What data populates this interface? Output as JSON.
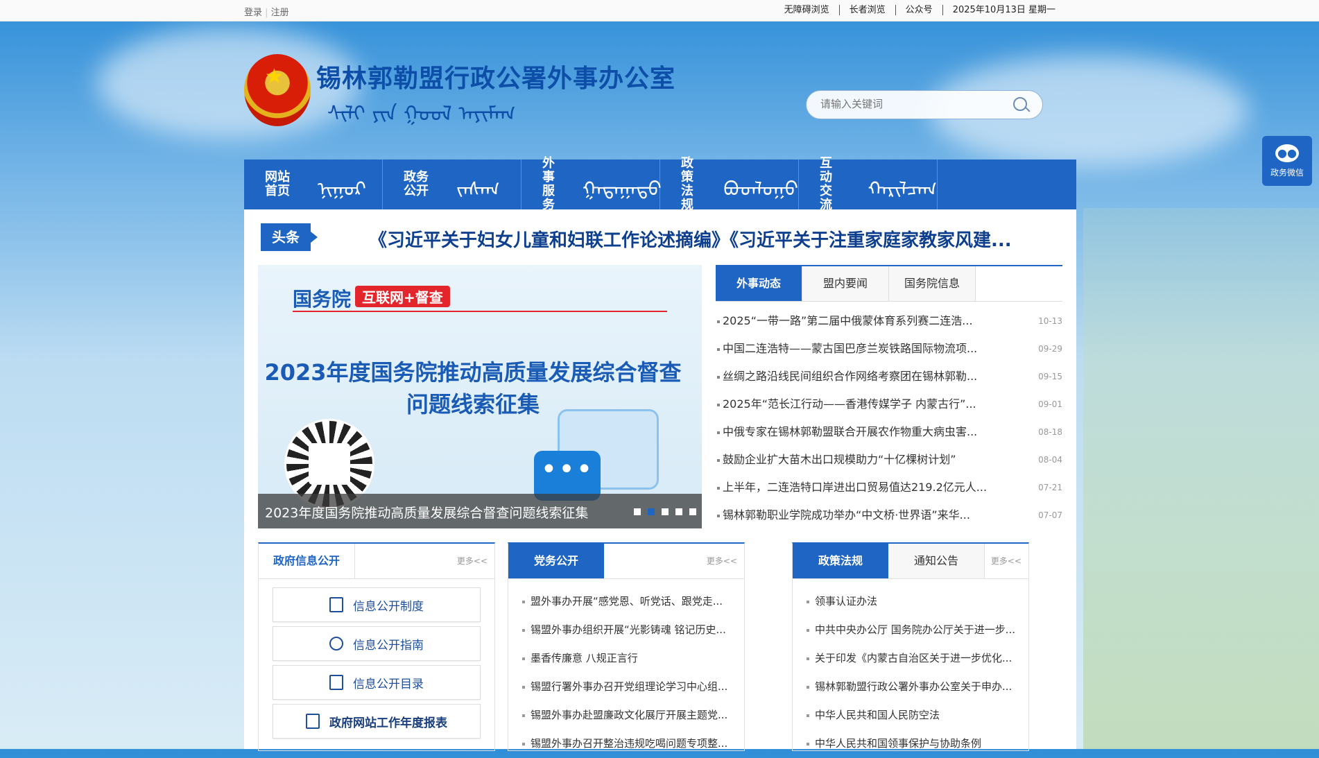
{
  "topbar": {
    "login": "登录",
    "register": "注册",
    "links": [
      "无障碍浏览",
      "长者浏览",
      "公众号",
      "2025年10月13日 星期一"
    ]
  },
  "header": {
    "title": "锡林郭勒盟行政公署外事办公室",
    "mongolian_title": "ᠰᠢᠯᠢ ᠶᠢᠨ ᠭᠣᠣᠯ ᠠᠶᠢᠮᠠᠭ",
    "search_placeholder": "请输入关键词"
  },
  "nav": [
    {
      "cn": "网站首页",
      "mn": "ᠨᠢᠭᠤᠷ"
    },
    {
      "cn": "政务公开",
      "mn": "ᠵᠠᠰᠠᠭ"
    },
    {
      "cn": "外事服务",
      "mn": "ᠭᠠᠳᠠᠭᠠᠳᠤ"
    },
    {
      "cn": "政策法规",
      "mn": "ᠪᠣᠳᠯᠣᠭᠣ"
    },
    {
      "cn": "互动交流",
      "mn": "ᠬᠠᠷᠢᠯᠴᠠᠭ"
    }
  ],
  "side": {
    "wechat_label": "政务微信"
  },
  "headline": {
    "tag": "头条",
    "text": "《习近平关于妇女儿童和妇联工作论述摘编》《习近平关于注重家庭家教家风建..."
  },
  "slider": {
    "brand": "国务院",
    "badge": "互联网+督查",
    "heading_line1": "2023年度国务院推动高质量发展综合督查",
    "heading_line2": "问题线索征集",
    "caption": "2023年度国务院推动高质量发展综合督查问题线索征集",
    "slide_count": 5,
    "active_slide": 2
  },
  "news": {
    "tabs": [
      "外事动态",
      "盟内要闻",
      "国务院信息"
    ],
    "active_tab": 0,
    "items": [
      {
        "title": "2025“一带一路”第二届中俄蒙体育系列赛二连浩...",
        "date": "10-13"
      },
      {
        "title": "中国二连浩特——蒙古国巴彦兰炭铁路国际物流项...",
        "date": "09-29"
      },
      {
        "title": "丝绸之路沿线民间组织合作网络考察团在锡林郭勒...",
        "date": "09-15"
      },
      {
        "title": "2025年“范长江行动——香港传媒学子 内蒙古行”...",
        "date": "09-01"
      },
      {
        "title": "中俄专家在锡林郭勒盟联合开展农作物重大病虫害...",
        "date": "08-18"
      },
      {
        "title": "鼓励企业扩大苗木出口规模助力“十亿棵树计划”",
        "date": "08-04"
      },
      {
        "title": "上半年，二连浩特口岸进出口贸易值达219.2亿元人...",
        "date": "07-21"
      },
      {
        "title": "锡林郭勒职业学院成功举办“中文桥·世界语”来华...",
        "date": "07-07"
      }
    ]
  },
  "col1": {
    "tab": "政府信息公开",
    "more": "更多<<",
    "buttons": [
      "信息公开制度",
      "信息公开指南",
      "信息公开目录",
      "政府网站工作年度报表"
    ]
  },
  "col2": {
    "tab": "党务公开",
    "more": "更多<<",
    "items": [
      "盟外事办开展“感党恩、听党话、跟党走...",
      "锡盟外事办组织开展“光影铸魂 铭记历史...",
      "墨香传廉意 八规正言行",
      "锡盟行署外事办召开党组理论学习中心组...",
      "锡盟外事办赴盟廉政文化展厅开展主题党...",
      "锡盟外事办召开整治违规吃喝问题专项整..."
    ]
  },
  "col3": {
    "tabs": [
      "政策法规",
      "通知公告"
    ],
    "more": "更多<<",
    "items": [
      "领事认证办法",
      "中共中央办公厅 国务院办公厅关于进一步...",
      "关于印发《内蒙古自治区关于进一步优化...",
      "锡林郭勒盟行政公署外事办公室关于申办...",
      "中华人民共和国人民防空法",
      "中华人民共和国领事保护与协助条例"
    ]
  },
  "colors": {
    "primary": "#1f65c3",
    "title": "#0d4fa8",
    "badge_red": "#e3262c"
  }
}
